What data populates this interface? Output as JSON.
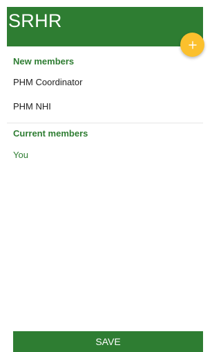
{
  "app_bar": {
    "title": "SRHR",
    "color": "#2e7d32"
  },
  "fab": {
    "icon": "plus-icon",
    "color": "#fbc02d"
  },
  "new_members": {
    "header": "New members",
    "items": [
      "PHM Coordinator",
      "PHM NHI"
    ]
  },
  "current_members": {
    "header": "Current members",
    "items": [
      "You"
    ]
  },
  "footer": {
    "save_label": "SAVE"
  }
}
